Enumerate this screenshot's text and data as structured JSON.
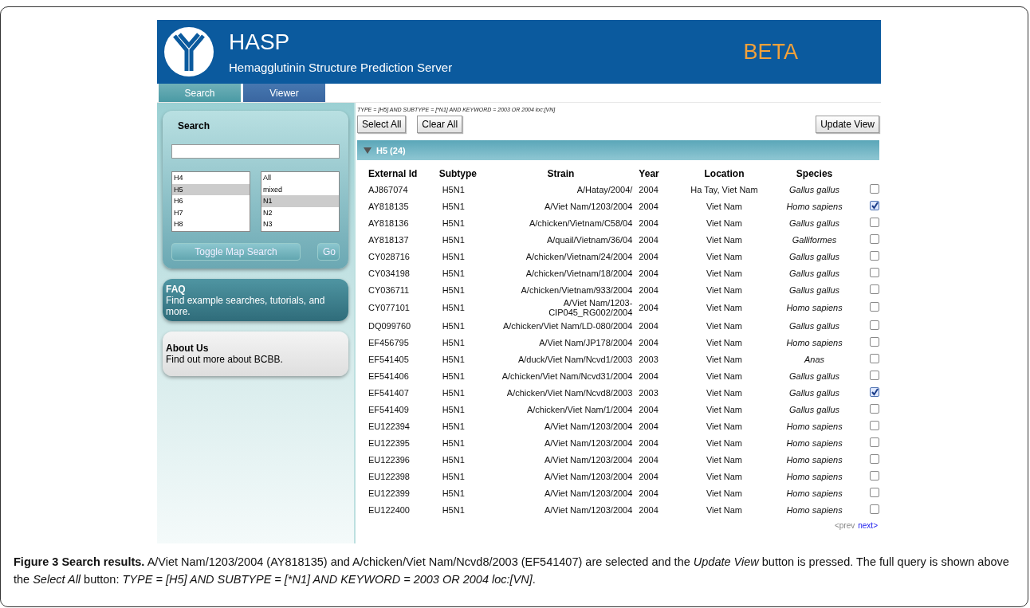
{
  "header": {
    "title": "HASP",
    "subtitle": "Hemagglutinin Structure Prediction Server",
    "badge": "BETA"
  },
  "tabs": [
    {
      "label": "Search",
      "selected": true
    },
    {
      "label": "Viewer",
      "selected": false
    }
  ],
  "search_panel": {
    "title": "Search",
    "type_list": [
      {
        "label": "H4",
        "selected": false
      },
      {
        "label": "H5",
        "selected": true
      },
      {
        "label": "H6",
        "selected": false
      },
      {
        "label": "H7",
        "selected": false
      },
      {
        "label": "H8",
        "selected": false
      }
    ],
    "subtype_list": [
      {
        "label": "All",
        "selected": false
      },
      {
        "label": "mixed",
        "selected": false
      },
      {
        "label": "N1",
        "selected": true
      },
      {
        "label": "N2",
        "selected": false
      },
      {
        "label": "N3",
        "selected": false
      }
    ],
    "buttons": [
      "Toggle Map Search",
      "Go"
    ]
  },
  "faq": {
    "title": "FAQ",
    "text": "Find example searches, tutorials, and more."
  },
  "about": {
    "title": "About Us",
    "text": "Find out more about BCBB."
  },
  "query": "TYPE = [H5] AND SUBTYPE = [*N1] AND KEYWORD = 2003 OR 2004 loc:[VN]",
  "toolbar": {
    "left": [
      "Select All",
      "Clear All"
    ],
    "right": "Update View"
  },
  "group": {
    "label": "H5 (24)",
    "expanded": true
  },
  "table": {
    "columns": [
      "External Id",
      "Subtype",
      "Strain",
      "Year",
      "Location",
      "Species"
    ],
    "rows": [
      {
        "cells": [
          "AJ867074",
          "H5N1",
          "A/Hatay/2004/",
          "2004",
          "Ha Tay, Viet Nam",
          "Gallus gallus"
        ],
        "checked": false
      },
      {
        "cells": [
          "AY818135",
          "H5N1",
          "A/Viet Nam/1203/2004",
          "2004",
          "Viet Nam",
          "Homo sapiens"
        ],
        "checked": true
      },
      {
        "cells": [
          "AY818136",
          "H5N1",
          "A/chicken/Vietnam/C58/04",
          "2004",
          "Viet Nam",
          "Gallus gallus"
        ],
        "checked": false
      },
      {
        "cells": [
          "AY818137",
          "H5N1",
          "A/quail/Vietnam/36/04",
          "2004",
          "Viet Nam",
          "Galliformes"
        ],
        "checked": false
      },
      {
        "cells": [
          "CY028716",
          "H5N1",
          "A/chicken/Vietnam/24/2004",
          "2004",
          "Viet Nam",
          "Gallus gallus"
        ],
        "checked": false
      },
      {
        "cells": [
          "CY034198",
          "H5N1",
          "A/chicken/Vietnam/18/2004",
          "2004",
          "Viet Nam",
          "Gallus gallus"
        ],
        "checked": false
      },
      {
        "cells": [
          "CY036711",
          "H5N1",
          "A/chicken/Vietnam/933/2004",
          "2004",
          "Viet Nam",
          "Gallus gallus"
        ],
        "checked": false
      },
      {
        "cells": [
          "CY077101",
          "H5N1",
          "A/Viet Nam/1203-CIP045_RG002/2004",
          "2004",
          "Viet Nam",
          "Homo sapiens"
        ],
        "checked": false
      },
      {
        "cells": [
          "DQ099760",
          "H5N1",
          "A/chicken/Viet Nam/LD-080/2004",
          "2004",
          "Viet Nam",
          "Gallus gallus"
        ],
        "checked": false
      },
      {
        "cells": [
          "EF456795",
          "H5N1",
          "A/Viet Nam/JP178/2004",
          "2004",
          "Viet Nam",
          "Homo sapiens"
        ],
        "checked": false
      },
      {
        "cells": [
          "EF541405",
          "H5N1",
          "A/duck/Viet Nam/Ncvd1/2003",
          "2003",
          "Viet Nam",
          "Anas"
        ],
        "checked": false
      },
      {
        "cells": [
          "EF541406",
          "H5N1",
          "A/chicken/Viet Nam/Ncvd31/2004",
          "2004",
          "Viet Nam",
          "Gallus gallus"
        ],
        "checked": false
      },
      {
        "cells": [
          "EF541407",
          "H5N1",
          "A/chicken/Viet Nam/Ncvd8/2003",
          "2003",
          "Viet Nam",
          "Gallus gallus"
        ],
        "checked": true
      },
      {
        "cells": [
          "EF541409",
          "H5N1",
          "A/chicken/Viet Nam/1/2004",
          "2004",
          "Viet Nam",
          "Gallus gallus"
        ],
        "checked": false
      },
      {
        "cells": [
          "EU122394",
          "H5N1",
          "A/Viet Nam/1203/2004",
          "2004",
          "Viet Nam",
          "Homo sapiens"
        ],
        "checked": false
      },
      {
        "cells": [
          "EU122395",
          "H5N1",
          "A/Viet Nam/1203/2004",
          "2004",
          "Viet Nam",
          "Homo sapiens"
        ],
        "checked": false
      },
      {
        "cells": [
          "EU122396",
          "H5N1",
          "A/Viet Nam/1203/2004",
          "2004",
          "Viet Nam",
          "Homo sapiens"
        ],
        "checked": false
      },
      {
        "cells": [
          "EU122398",
          "H5N1",
          "A/Viet Nam/1203/2004",
          "2004",
          "Viet Nam",
          "Homo sapiens"
        ],
        "checked": false
      },
      {
        "cells": [
          "EU122399",
          "H5N1",
          "A/Viet Nam/1203/2004",
          "2004",
          "Viet Nam",
          "Homo sapiens"
        ],
        "checked": false
      },
      {
        "cells": [
          "EU122400",
          "H5N1",
          "A/Viet Nam/1203/2004",
          "2004",
          "Viet Nam",
          "Homo sapiens"
        ],
        "checked": false
      }
    ]
  },
  "pager": [
    {
      "label": "<prev",
      "disabled": true
    },
    {
      "label": "next>",
      "disabled": false
    }
  ],
  "caption": {
    "text": "**Figure 3 Search results.** A/Viet Nam/1203/2004 (AY818135) and A/chicken/Viet Nam/Ncvd8/2003 (EF541407) are selected and the *Update View* button is pressed. The full query is shown above the *Select All* button: ",
    "query": "TYPE = [H5] AND SUBTYPE = [*N1] AND KEYWORD = 2003 OR 2004 loc:[VN]",
    "end": "."
  }
}
